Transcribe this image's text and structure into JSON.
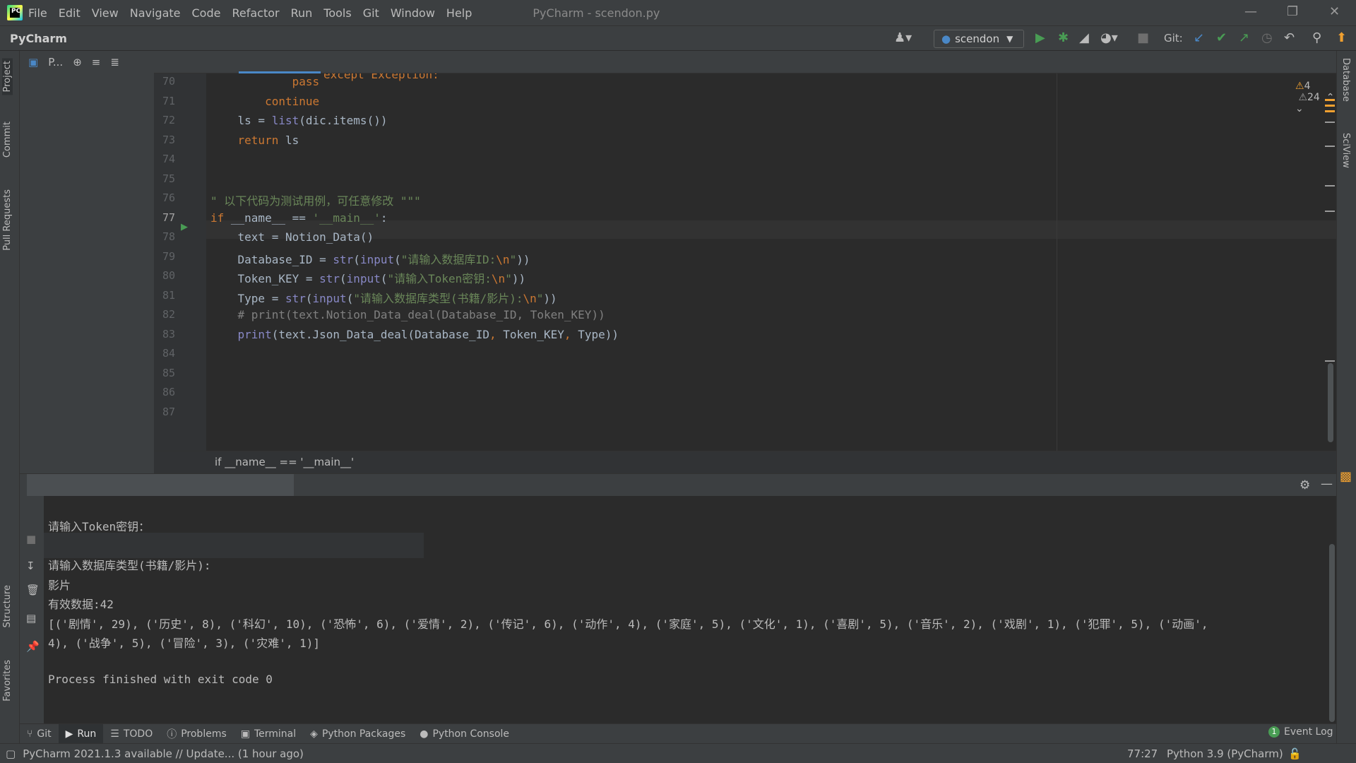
{
  "window": {
    "title": "PyCharm - scendon.py",
    "app_name": "PyCharm",
    "minimize": "—",
    "restore": "❐",
    "close": "✕"
  },
  "menu": [
    "File",
    "Edit",
    "View",
    "Navigate",
    "Code",
    "Refactor",
    "Run",
    "Tools",
    "Git",
    "Window",
    "Help"
  ],
  "toolbar": {
    "run_config": "scendon",
    "git_label": "Git:"
  },
  "left_tabs": {
    "project": "Project",
    "commit": "Commit",
    "pull_requests": "Pull Requests",
    "structure": "Structure",
    "favorites": "Favorites"
  },
  "right_tabs": {
    "database": "Database",
    "sciview": "SciView"
  },
  "project_panel": {
    "label": "P..."
  },
  "editor": {
    "warnings": {
      "weak": "4",
      "count": "24"
    },
    "lines": [
      {
        "n": "70",
        "t": "            pass"
      },
      {
        "n": "71",
        "t": "        continue"
      },
      {
        "n": "72",
        "t": "    ls = list(dic.items())"
      },
      {
        "n": "73",
        "t": "    return ls"
      },
      {
        "n": "74",
        "t": ""
      },
      {
        "n": "75",
        "t": ""
      },
      {
        "n": "76",
        "t": "\" 以下代码为测试用例，可任意修改 \"\"\""
      },
      {
        "n": "77",
        "t": "if __name__ == '__main__':"
      },
      {
        "n": "78",
        "t": "    text = Notion_Data()"
      },
      {
        "n": "79",
        "t": "    Database_ID = str(input(\"请输入数据库ID:\\n\"))"
      },
      {
        "n": "80",
        "t": "    Token_KEY = str(input(\"请输入Token密钥:\\n\"))"
      },
      {
        "n": "81",
        "t": "    Type = str(input(\"请输入数据库类型(书籍/影片):\\n\"))"
      },
      {
        "n": "82",
        "t": "    # print(text.Notion_Data_deal(Database_ID, Token_KEY))"
      },
      {
        "n": "83",
        "t": "    print(text.Json_Data_deal(Database_ID, Token_KEY, Type))"
      },
      {
        "n": "84",
        "t": ""
      },
      {
        "n": "85",
        "t": ""
      },
      {
        "n": "86",
        "t": ""
      },
      {
        "n": "87",
        "t": ""
      }
    ],
    "partial_top": "except Exception:",
    "breadcrumb": "if __name__ == '__main__'"
  },
  "console": {
    "lines": [
      "请输入Token密钥：",
      "",
      "请输入数据库类型(书籍/影片):",
      "影片",
      "有效数据:42",
      "[('剧情', 29), ('历史', 8), ('科幻', 10), ('恐怖', 6), ('爱情', 2), ('传记', 6), ('动作', 4), ('家庭', 5), ('文化', 1), ('喜剧', 5), ('音乐', 2), ('戏剧', 1), ('犯罪', 5), ('动画',",
      "4), ('战争', 5), ('冒险', 3), ('灾难', 1)]",
      "",
      "Process finished with exit code 0"
    ]
  },
  "bottom_tabs": [
    {
      "label": "Git",
      "icon": "git-branch-icon"
    },
    {
      "label": "Run",
      "icon": "run-icon",
      "active": true
    },
    {
      "label": "TODO",
      "icon": "list-icon"
    },
    {
      "label": "Problems",
      "icon": "info-icon"
    },
    {
      "label": "Terminal",
      "icon": "terminal-icon"
    },
    {
      "label": "Python Packages",
      "icon": "packages-icon"
    },
    {
      "label": "Python Console",
      "icon": "python-icon"
    }
  ],
  "event_log": {
    "count": "1",
    "label": "Event Log"
  },
  "status": {
    "message": "PyCharm 2021.1.3 available // Update... (1 hour ago)",
    "position": "77:27",
    "interpreter": "Python 3.9 (PyCharm)"
  },
  "colors": {
    "keyword": "#cc7832",
    "string": "#6a8759",
    "builtin": "#8888c6",
    "comment": "#808080",
    "text": "#a9b7c6",
    "run_green": "#499c54"
  }
}
